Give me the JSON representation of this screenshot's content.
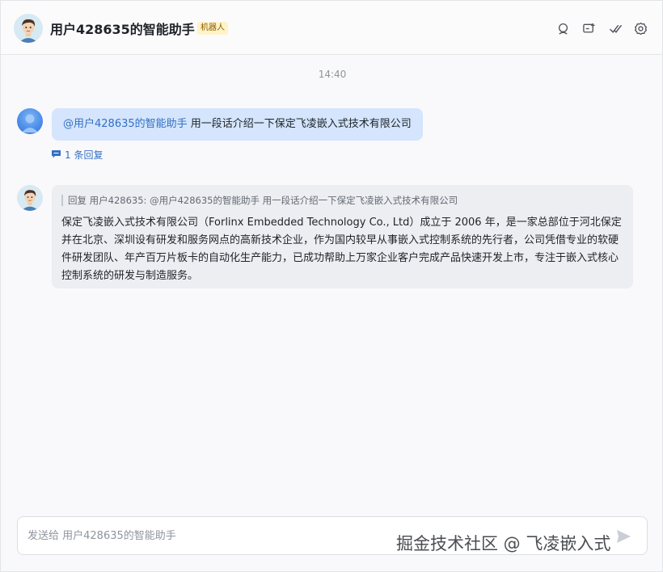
{
  "header": {
    "title": "用户428635的智能助手",
    "badge": "机器人"
  },
  "timestamp": "14:40",
  "user_message": {
    "mention": "@用户428635的智能助手",
    "text": " 用一段话介绍一下保定飞凌嵌入式技术有限公司",
    "reply_count": "1 条回复"
  },
  "bot_message": {
    "quote": "回复 用户428635:  @用户428635的智能助手 用一段话介绍一下保定飞凌嵌入式技术有限公司",
    "text": "保定飞凌嵌入式技术有限公司（Forlinx Embedded Technology Co., Ltd）成立于 2006 年，是一家总部位于河北保定并在北京、深圳设有研发和服务网点的高新技术企业，作为国内较早从事嵌入式控制系统的先行者，公司凭借专业的软硬件研发团队、年产百万片板卡的自动化生产能力，已成功帮助上万家企业客户完成产品快速开发上市，专注于嵌入式核心控制系统的研发与制造服务。"
  },
  "input": {
    "placeholder": "发送给 用户428635的智能助手"
  },
  "watermark": "掘金技术社区 @ 飞凌嵌入式",
  "colors": {
    "user_bubble": "#d4e5fd",
    "bot_bubble": "#eceef1",
    "mention": "#3370c4",
    "badge_bg": "#fff3c7"
  },
  "icons": [
    "search-icon",
    "add-tab-icon",
    "checkmark-icon",
    "gear-icon",
    "comment-icon",
    "send-icon"
  ]
}
